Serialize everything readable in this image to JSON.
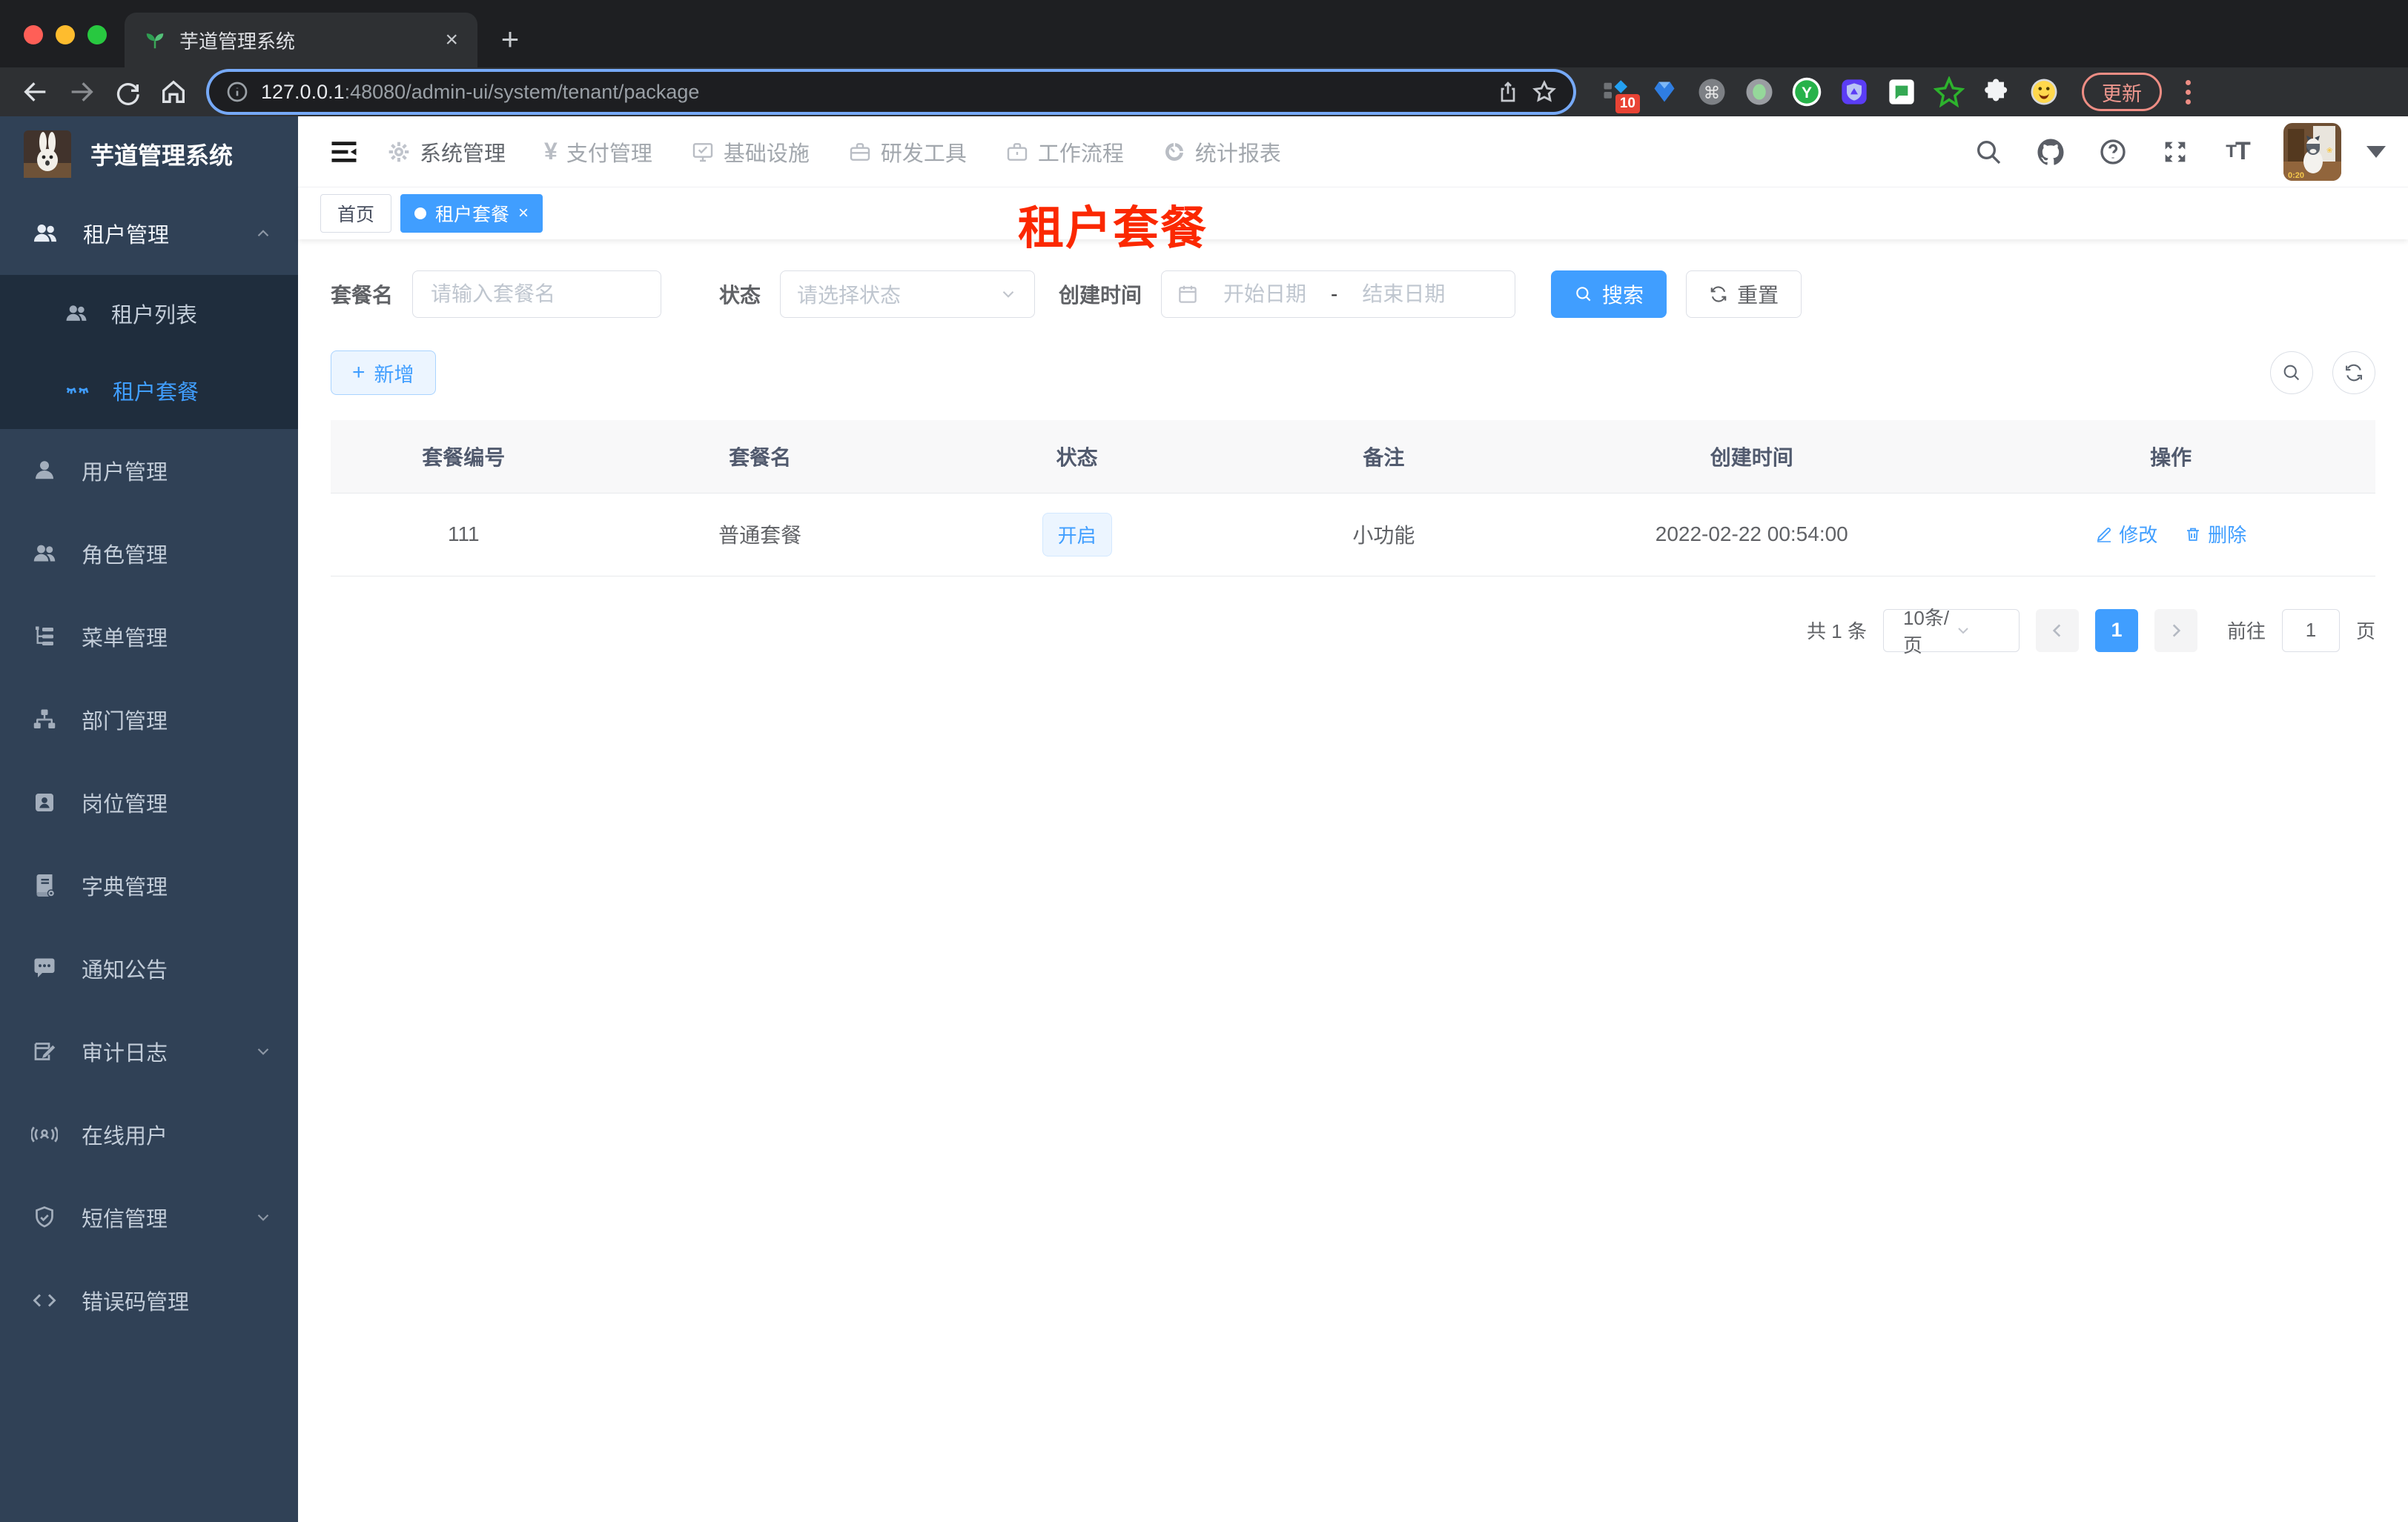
{
  "browser": {
    "tab_title": "芋道管理系统",
    "url_host": "127.0.0.1",
    "url_path": ":48080/admin-ui/system/tenant/package",
    "extension_badge": "10",
    "update_label": "更新",
    "new_tab_glyph": "+",
    "close_glyph": "×"
  },
  "sidebar": {
    "logo_title": "芋道管理系统",
    "items": [
      {
        "label": "租户管理",
        "icon": "users-icon",
        "state": "open"
      },
      {
        "label": "租户列表",
        "icon": "users-icon",
        "state": "normal"
      },
      {
        "label": "租户套餐",
        "icon": "package-icon",
        "state": "active"
      },
      {
        "label": "用户管理",
        "icon": "user-icon",
        "state": "normal"
      },
      {
        "label": "角色管理",
        "icon": "users-icon",
        "state": "normal"
      },
      {
        "label": "菜单管理",
        "icon": "tree-menu-icon",
        "state": "normal"
      },
      {
        "label": "部门管理",
        "icon": "org-chart-icon",
        "state": "normal"
      },
      {
        "label": "岗位管理",
        "icon": "badge-icon",
        "state": "normal"
      },
      {
        "label": "字典管理",
        "icon": "dictionary-icon",
        "state": "normal"
      },
      {
        "label": "通知公告",
        "icon": "announcement-icon",
        "state": "normal"
      },
      {
        "label": "审计日志",
        "icon": "audit-log-icon",
        "state": "collapsed"
      },
      {
        "label": "在线用户",
        "icon": "online-user-icon",
        "state": "normal"
      },
      {
        "label": "短信管理",
        "icon": "sms-shield-icon",
        "state": "collapsed"
      },
      {
        "label": "错误码管理",
        "icon": "code-icon",
        "state": "normal"
      }
    ]
  },
  "header": {
    "menu": [
      {
        "label": "系统管理",
        "icon": "gear-icon",
        "active": true
      },
      {
        "label": "支付管理",
        "icon": "yen-icon",
        "active": false
      },
      {
        "label": "基础设施",
        "icon": "monitor-icon",
        "active": false
      },
      {
        "label": "研发工具",
        "icon": "toolbox-icon",
        "active": false
      },
      {
        "label": "工作流程",
        "icon": "briefcase-icon",
        "active": false
      },
      {
        "label": "统计报表",
        "icon": "dashboard-icon",
        "active": false
      }
    ],
    "right_icons": [
      "search-icon",
      "github-icon",
      "help-icon",
      "fullscreen-icon",
      "font-size-icon",
      "avatar",
      "caret-down-icon"
    ],
    "font_size_glyph_small": "T",
    "font_size_glyph_big": "T"
  },
  "tags": {
    "home_label": "首页",
    "active_label": "租户套餐",
    "close_glyph": "×"
  },
  "annotation": "租户套餐",
  "filters": {
    "name_label": "套餐名",
    "name_placeholder": "请输入套餐名",
    "status_label": "状态",
    "status_placeholder": "请选择状态",
    "date_label": "创建时间",
    "date_start_placeholder": "开始日期",
    "date_separator": "-",
    "date_end_placeholder": "结束日期",
    "search_label": "搜索",
    "reset_label": "重置"
  },
  "toolbar": {
    "add_label": "新增",
    "plus_glyph": "+"
  },
  "table": {
    "columns": [
      "套餐编号",
      "套餐名",
      "状态",
      "备注",
      "创建时间",
      "操作"
    ],
    "rows": [
      {
        "id": "111",
        "name": "普通套餐",
        "status": "开启",
        "remark": "小功能",
        "created": "2022-02-22 00:54:00",
        "actions": [
          "修改",
          "删除"
        ]
      }
    ]
  },
  "pager": {
    "total": "共 1 条",
    "page_size": "10条/页",
    "current_page": "1",
    "goto_prefix": "前往",
    "goto_value": "1",
    "goto_suffix": "页"
  },
  "colors": {
    "accent": "#409eff",
    "sidebar_bg": "#304156",
    "submenu_bg": "#1f2d3d",
    "annotation_red": "#fb2800",
    "tag_active": "#409eff"
  }
}
